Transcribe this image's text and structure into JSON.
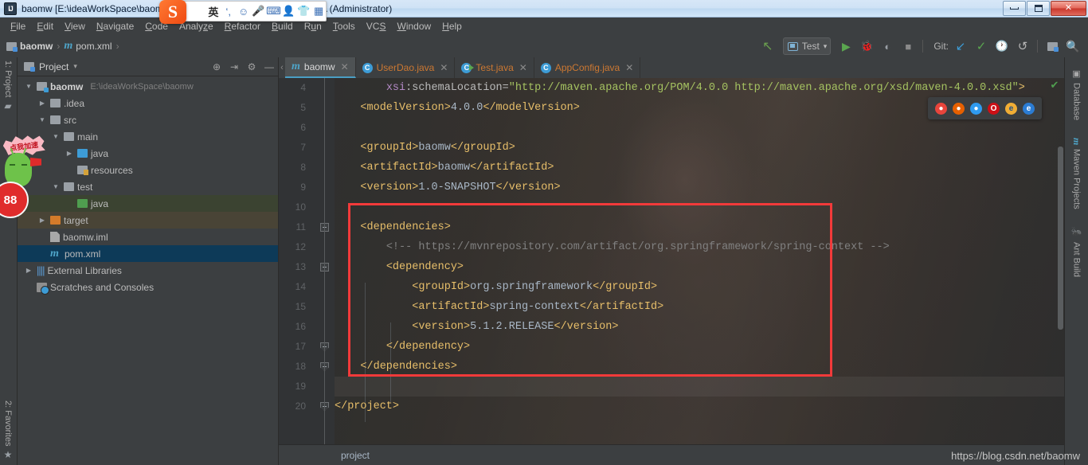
{
  "window": {
    "title": "baomw [E:\\ideaWorkSpace\\baomw] - ...\\pom.xml [baomw] - IntelliJ IDEA (Administrator)",
    "app_icon": "IJ",
    "buttons": {
      "minimize": "minimize-icon",
      "maximize": "restore-icon",
      "close": "✕"
    }
  },
  "ime": {
    "logo": "S",
    "icons": [
      "英",
      "‘,",
      "☺",
      "Ἲ4",
      "⌨",
      "὆4",
      "ὅ5",
      "▦"
    ],
    "lang_label": "英"
  },
  "menu": {
    "items": [
      {
        "label": "File",
        "mnemonic": "F"
      },
      {
        "label": "Edit",
        "mnemonic": "E"
      },
      {
        "label": "View",
        "mnemonic": "V"
      },
      {
        "label": "Navigate",
        "mnemonic": "N"
      },
      {
        "label": "Code",
        "mnemonic": "C"
      },
      {
        "label": "Analyze",
        "mnemonic": "z"
      },
      {
        "label": "Refactor",
        "mnemonic": "R"
      },
      {
        "label": "Build",
        "mnemonic": "B"
      },
      {
        "label": "Run",
        "mnemonic": "u"
      },
      {
        "label": "Tools",
        "mnemonic": "T"
      },
      {
        "label": "VCS",
        "mnemonic": "S"
      },
      {
        "label": "Window",
        "mnemonic": "W"
      },
      {
        "label": "Help",
        "mnemonic": "H"
      }
    ]
  },
  "navbar": {
    "breadcrumbs": [
      {
        "label": "baomw",
        "icon": "module-icon"
      },
      {
        "label": "pom.xml",
        "icon": "maven-file-icon"
      }
    ],
    "separator": "›"
  },
  "toolbar": {
    "build_label": "build-icon",
    "run_config": "Test",
    "run_config_caret": "▾",
    "run_label": "run-icon",
    "debug_label": "debug-icon",
    "coverage_label": "run-with-coverage-icon",
    "stop_label": "stop-icon",
    "git_label": "Git:",
    "git_update": "update-project-icon",
    "git_commit": "commit-icon",
    "git_history": "history-icon",
    "git_revert": "rollback-icon",
    "project_structure": "project-structure-icon",
    "search": "search-everywhere-icon"
  },
  "rail_left": {
    "project": "1: Project",
    "favorites": "2: Favorites"
  },
  "rail_right": {
    "items": [
      "Database",
      "Maven Projects",
      "Ant Build"
    ]
  },
  "project_panel": {
    "title": "Project",
    "caret": "▾",
    "icons": [
      "locate-icon",
      "collapse-all-icon",
      "settings-gear-icon",
      "hide-icon"
    ],
    "tree": [
      {
        "label": "baomw",
        "path": "E:\\ideaWorkSpace\\baomw",
        "arrow": "▼",
        "icon": "module",
        "indent": 0,
        "bold": true,
        "state": "none"
      },
      {
        "label": ".idea",
        "path": "",
        "arrow": "▶",
        "icon": "folder",
        "indent": 1,
        "bold": false,
        "state": "none"
      },
      {
        "label": "src",
        "path": "",
        "arrow": "▼",
        "icon": "folder",
        "indent": 1,
        "bold": false,
        "state": "none"
      },
      {
        "label": "main",
        "path": "",
        "arrow": "▼",
        "icon": "folder",
        "indent": 2,
        "bold": false,
        "state": "none"
      },
      {
        "label": "java",
        "path": "",
        "arrow": "▶",
        "icon": "folder-blue",
        "indent": 3,
        "bold": false,
        "state": "none"
      },
      {
        "label": "resources",
        "path": "",
        "arrow": "",
        "icon": "folder-resources",
        "indent": 3,
        "bold": false,
        "state": "none"
      },
      {
        "label": "test",
        "path": "",
        "arrow": "▼",
        "icon": "folder",
        "indent": 2,
        "bold": false,
        "state": "none"
      },
      {
        "label": "java",
        "path": "",
        "arrow": "",
        "icon": "folder-green",
        "indent": 3,
        "bold": false,
        "state": "green"
      },
      {
        "label": "target",
        "path": "",
        "arrow": "▶",
        "icon": "folder-orange",
        "indent": 1,
        "bold": false,
        "state": "brown"
      },
      {
        "label": "baomw.iml",
        "path": "",
        "arrow": "",
        "icon": "iml",
        "indent": 1,
        "bold": false,
        "state": "none"
      },
      {
        "label": "pom.xml",
        "path": "",
        "arrow": "",
        "icon": "pom",
        "indent": 1,
        "bold": false,
        "state": "blue"
      },
      {
        "label": "External Libraries",
        "path": "",
        "arrow": "▶",
        "icon": "library",
        "indent": 0,
        "bold": false,
        "state": "none"
      },
      {
        "label": "Scratches and Consoles",
        "path": "",
        "arrow": "",
        "icon": "scratches",
        "indent": 0,
        "bold": false,
        "state": "none"
      }
    ]
  },
  "editor": {
    "tabs": [
      {
        "label": "baomw",
        "icon": "maven-icon",
        "active": true,
        "close": "✕"
      },
      {
        "label": "UserDao.java",
        "icon": "class-icon",
        "active": false,
        "close": "✕"
      },
      {
        "label": "Test.java",
        "icon": "runnable-class-icon",
        "active": false,
        "close": "✕"
      },
      {
        "label": "AppConfig.java",
        "icon": "class-icon",
        "active": false,
        "close": "✕"
      }
    ],
    "first_line_number": 4,
    "current_line": 19,
    "line_numbers": [
      4,
      5,
      6,
      7,
      8,
      9,
      10,
      11,
      12,
      13,
      14,
      15,
      16,
      17,
      18,
      19,
      20
    ],
    "lines": [
      {
        "n": 4,
        "indent": 0,
        "segments": [
          {
            "t": "        ",
            "c": "txt"
          },
          {
            "t": "xsi",
            "c": "ns"
          },
          {
            "t": ":schemaLocation=",
            "c": "attr"
          },
          {
            "t": "\"http://maven.apache.org/POM/4.0.0 http://maven.apache.org/xsd/maven-4.0.0.xsd\"",
            "c": "val"
          },
          {
            "t": ">",
            "c": "tag"
          }
        ]
      },
      {
        "n": 5,
        "indent": 0,
        "segments": [
          {
            "t": "    ",
            "c": "txt"
          },
          {
            "t": "<modelVersion>",
            "c": "tag"
          },
          {
            "t": "4.0.0",
            "c": "txt"
          },
          {
            "t": "</modelVersion>",
            "c": "tag"
          }
        ]
      },
      {
        "n": 6,
        "indent": 0,
        "segments": []
      },
      {
        "n": 7,
        "indent": 0,
        "segments": [
          {
            "t": "    ",
            "c": "txt"
          },
          {
            "t": "<groupId>",
            "c": "tag"
          },
          {
            "t": "baomw",
            "c": "txt"
          },
          {
            "t": "</groupId>",
            "c": "tag"
          }
        ]
      },
      {
        "n": 8,
        "indent": 0,
        "segments": [
          {
            "t": "    ",
            "c": "txt"
          },
          {
            "t": "<artifactId>",
            "c": "tag"
          },
          {
            "t": "baomw",
            "c": "txt"
          },
          {
            "t": "</artifactId>",
            "c": "tag"
          }
        ]
      },
      {
        "n": 9,
        "indent": 0,
        "segments": [
          {
            "t": "    ",
            "c": "txt"
          },
          {
            "t": "<version>",
            "c": "tag"
          },
          {
            "t": "1.0-SNAPSHOT",
            "c": "txt"
          },
          {
            "t": "</version>",
            "c": "tag"
          }
        ]
      },
      {
        "n": 10,
        "indent": 0,
        "segments": []
      },
      {
        "n": 11,
        "indent": 0,
        "segments": [
          {
            "t": "    ",
            "c": "txt"
          },
          {
            "t": "<dependencies>",
            "c": "tag"
          }
        ]
      },
      {
        "n": 12,
        "indent": 0,
        "segments": [
          {
            "t": "        ",
            "c": "txt"
          },
          {
            "t": "<!-- https://mvnrepository.com/artifact/org.springframework/spring-context -->",
            "c": "cmt"
          }
        ]
      },
      {
        "n": 13,
        "indent": 0,
        "segments": [
          {
            "t": "        ",
            "c": "txt"
          },
          {
            "t": "<dependency>",
            "c": "tag"
          }
        ]
      },
      {
        "n": 14,
        "indent": 0,
        "segments": [
          {
            "t": "            ",
            "c": "txt"
          },
          {
            "t": "<groupId>",
            "c": "tag"
          },
          {
            "t": "org.springframework",
            "c": "txt"
          },
          {
            "t": "</groupId>",
            "c": "tag"
          }
        ]
      },
      {
        "n": 15,
        "indent": 0,
        "segments": [
          {
            "t": "            ",
            "c": "txt"
          },
          {
            "t": "<artifactId>",
            "c": "tag"
          },
          {
            "t": "spring-context",
            "c": "txt"
          },
          {
            "t": "</artifactId>",
            "c": "tag"
          }
        ]
      },
      {
        "n": 16,
        "indent": 0,
        "segments": [
          {
            "t": "            ",
            "c": "txt"
          },
          {
            "t": "<version>",
            "c": "tag"
          },
          {
            "t": "5.1.2.RELEASE",
            "c": "txt"
          },
          {
            "t": "</version>",
            "c": "tag"
          }
        ]
      },
      {
        "n": 17,
        "indent": 0,
        "segments": [
          {
            "t": "        ",
            "c": "txt"
          },
          {
            "t": "</dependency>",
            "c": "tag"
          }
        ]
      },
      {
        "n": 18,
        "indent": 0,
        "segments": [
          {
            "t": "    ",
            "c": "txt"
          },
          {
            "t": "</dependencies>",
            "c": "tag"
          }
        ]
      },
      {
        "n": 19,
        "indent": 0,
        "segments": []
      },
      {
        "n": 20,
        "indent": 0,
        "segments": [
          {
            "t": "",
            "c": "txt"
          },
          {
            "t": "</project>",
            "c": "tag"
          }
        ]
      }
    ],
    "fold_markers": [
      11,
      13,
      17,
      18,
      20
    ],
    "breadcrumb": "project",
    "browser_popup": [
      "chrome-icon",
      "firefox-icon",
      "safari-icon",
      "opera-icon",
      "ie-icon",
      "edge-icon"
    ],
    "annotation": {
      "type": "red-rectangle",
      "color": "#f23a3a"
    }
  },
  "watermark": "https://blog.csdn.net/baomw",
  "ad": {
    "bubble_text": "点我加速",
    "badge": "88"
  },
  "colors": {
    "accent": "#4a9ec4",
    "tag": "#e8bf6a",
    "value": "#a5c261",
    "annotation": "#f23a3a",
    "selection": "#0d3a58"
  }
}
